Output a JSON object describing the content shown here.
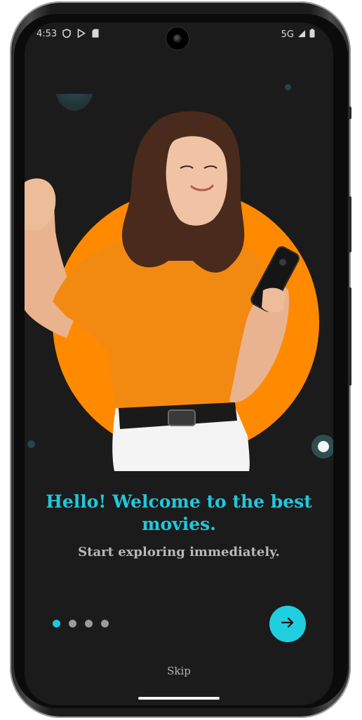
{
  "status_bar": {
    "time": "4:53",
    "network": "5G"
  },
  "onboarding": {
    "title": "Hello! Welcome to the best movies.",
    "subtitle": "Start exploring immediately.",
    "page_index": 1,
    "page_count": 4,
    "skip_label": "Skip"
  },
  "colors": {
    "accent": "#22c7dc",
    "hero_circle": "#ff8a00",
    "background": "#1b1b1b",
    "shirt": "#f28a12"
  },
  "icons": {
    "next": "arrow-right-icon",
    "shield": "shield-icon",
    "play_store": "play-store-icon",
    "sim": "sim-card-icon",
    "signal": "signal-icon",
    "battery": "battery-icon"
  }
}
